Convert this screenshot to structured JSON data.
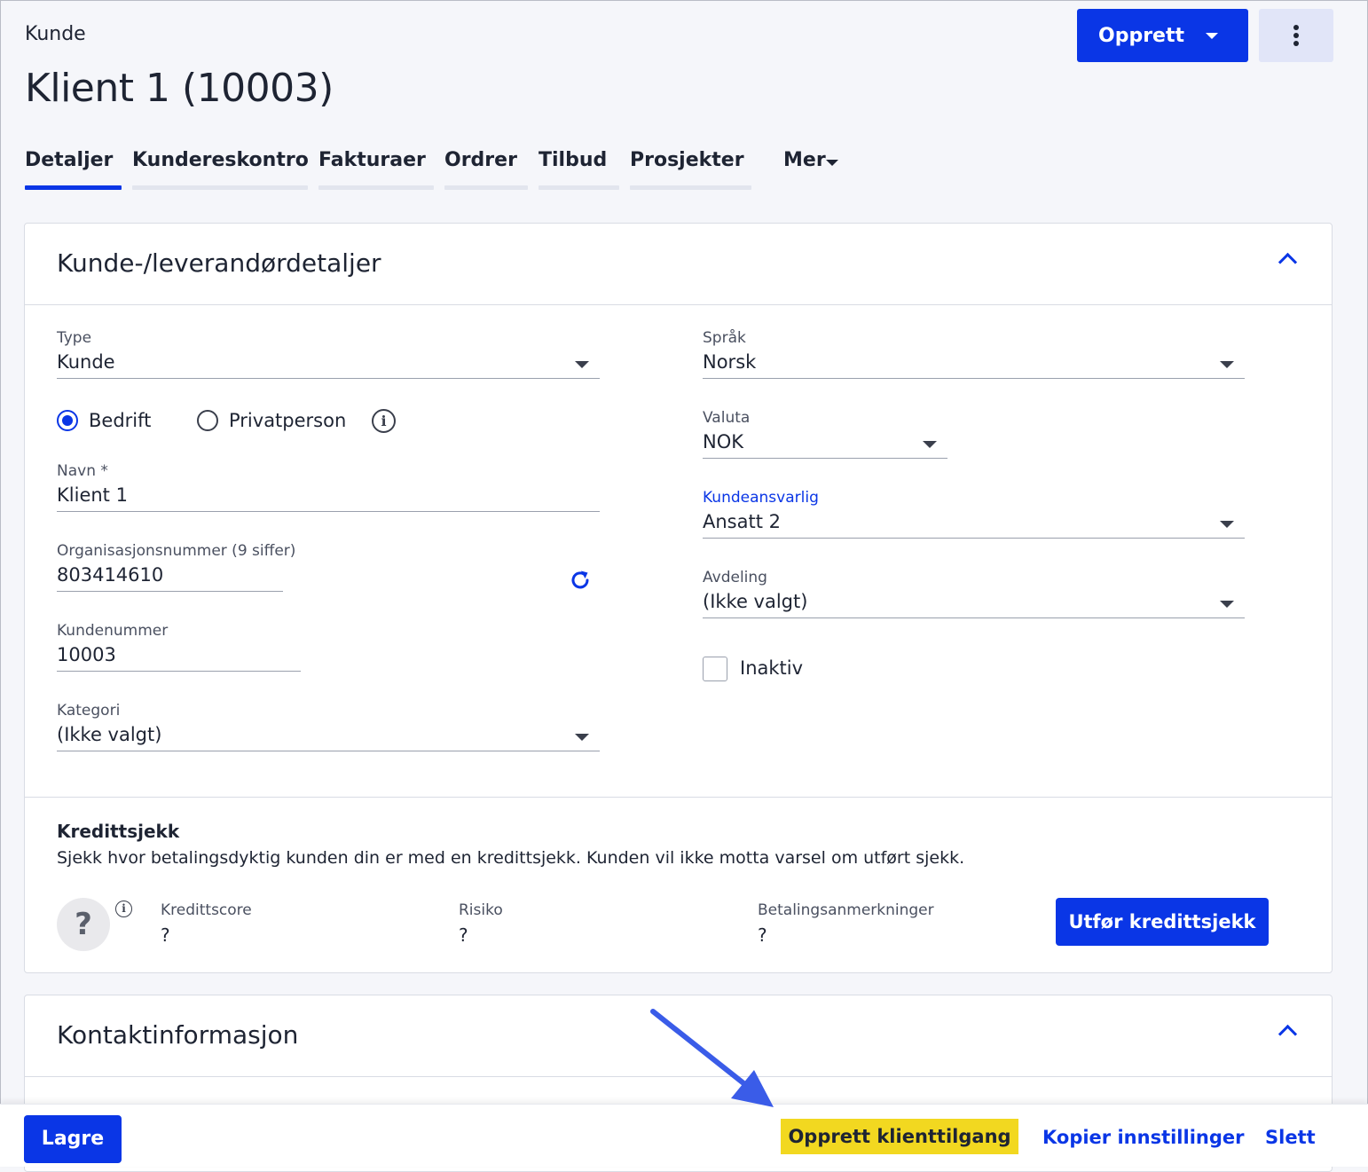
{
  "header": {
    "breadcrumb": "Kunde",
    "title": "Klient 1 (10003)",
    "create_button": "Opprett",
    "more_menu_icon": "vertical-dots-icon"
  },
  "tabs": [
    {
      "label": "Detaljer",
      "active": true
    },
    {
      "label": "Kundereskontro"
    },
    {
      "label": "Fakturaer"
    },
    {
      "label": "Ordrer"
    },
    {
      "label": "Tilbud"
    },
    {
      "label": "Prosjekter"
    },
    {
      "label": "Mer"
    }
  ],
  "details": {
    "title": "Kunde-/leverandørdetaljer",
    "type": {
      "label": "Type",
      "value": "Kunde"
    },
    "entity": {
      "options": [
        "Bedrift",
        "Privatperson"
      ],
      "selected": "Bedrift"
    },
    "name": {
      "label": "Navn *",
      "value": "Klient 1"
    },
    "org": {
      "label": "Organisasjonsnummer (9 siffer)",
      "value": "803414610"
    },
    "customer_no": {
      "label": "Kundenummer",
      "value": "10003"
    },
    "category": {
      "label": "Kategori",
      "value": "(Ikke valgt)"
    },
    "language": {
      "label": "Språk",
      "value": "Norsk"
    },
    "currency": {
      "label": "Valuta",
      "value": "NOK"
    },
    "responsible": {
      "label": "Kundeansvarlig",
      "value": "Ansatt 2"
    },
    "department": {
      "label": "Avdeling",
      "value": "(Ikke valgt)"
    },
    "inactive": {
      "label": "Inaktiv",
      "checked": false
    }
  },
  "credit": {
    "title": "Kredittsjekk",
    "description": "Sjekk hvor betalingsdyktig kunden din er med en kredittsjekk. Kunden vil ikke motta varsel om utført sjekk.",
    "avatar": "?",
    "score": {
      "label": "Kredittscore",
      "value": "?"
    },
    "risk": {
      "label": "Risiko",
      "value": "?"
    },
    "remarks": {
      "label": "Betalingsanmerkninger",
      "value": "?"
    },
    "button": "Utfør kredittsjekk"
  },
  "contact": {
    "title": "Kontaktinformasjon"
  },
  "footer": {
    "save": "Lagre",
    "create_client_access": "Opprett klienttilgang",
    "copy_settings": "Kopier innstillinger",
    "delete": "Slett"
  },
  "colors": {
    "accent": "#0a36e6",
    "highlight": "#f2d820",
    "annotation_arrow": "#3a5ce8"
  }
}
